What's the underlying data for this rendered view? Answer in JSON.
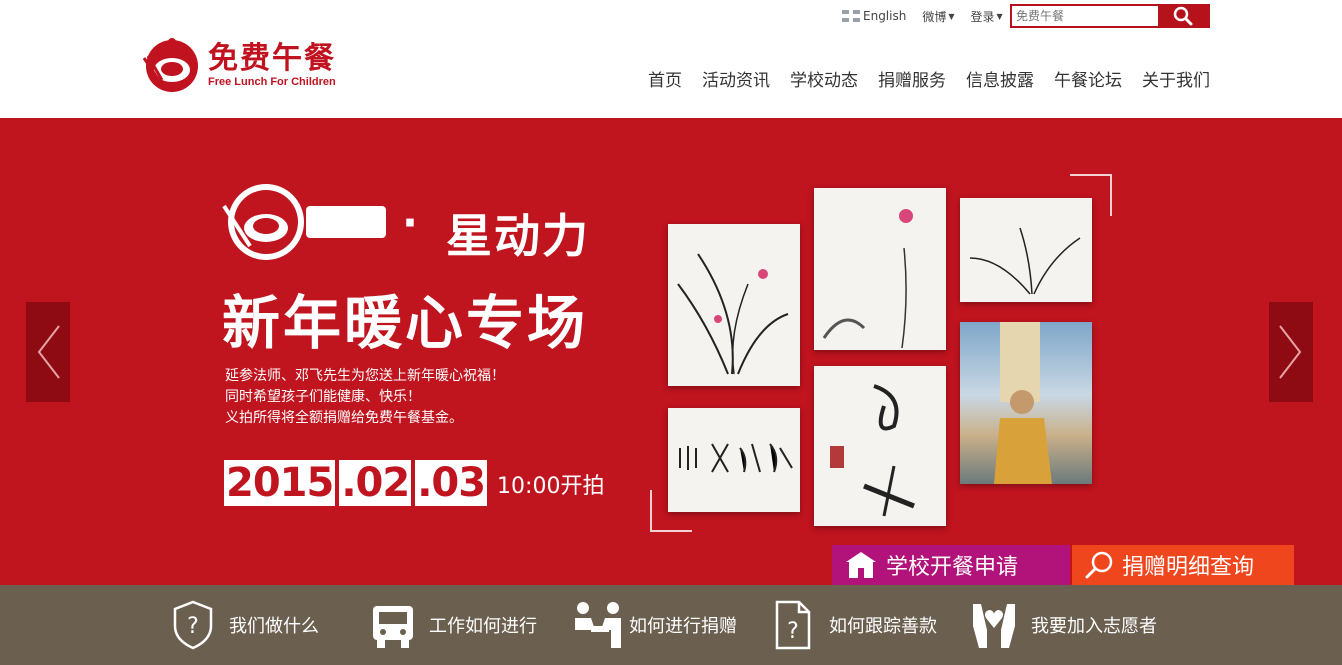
{
  "util": {
    "english": "English",
    "weibo": "微博",
    "login": "登录",
    "search_placeholder": "免费午餐"
  },
  "logo": {
    "cn": "免费午餐",
    "en": "Free Lunch For Children"
  },
  "nav": [
    "首页",
    "活动资讯",
    "学校动态",
    "捐赠服务",
    "信息披露",
    "午餐论坛",
    "关于我们"
  ],
  "banner": {
    "title1": "星动力",
    "dot": "·",
    "title2": "新年暖心专场",
    "desc": [
      "延参法师、邓飞先生为您送上新年暖心祝福！",
      "同时希望孩子们能健康、快乐！",
      "义拍所得将全额捐赠给免费午餐基金。"
    ],
    "date_parts": [
      "2015",
      ".02",
      ".03"
    ],
    "time": "10:00开拍",
    "apply": "学校开餐申请",
    "query": "捐赠明细查询"
  },
  "bottom": [
    {
      "label": "我们做什么",
      "icon": "shield-question-icon"
    },
    {
      "label": "工作如何进行",
      "icon": "truck-icon"
    },
    {
      "label": "如何进行捐赠",
      "icon": "donate-people-icon"
    },
    {
      "label": "如何跟踪善款",
      "icon": "document-question-icon"
    },
    {
      "label": "我要加入志愿者",
      "icon": "hands-heart-icon"
    }
  ],
  "colors": {
    "brand_red": "#c0141f",
    "magenta": "#b2137a",
    "orange": "#f0461e",
    "bottom_bar": "#6b5f4f"
  }
}
